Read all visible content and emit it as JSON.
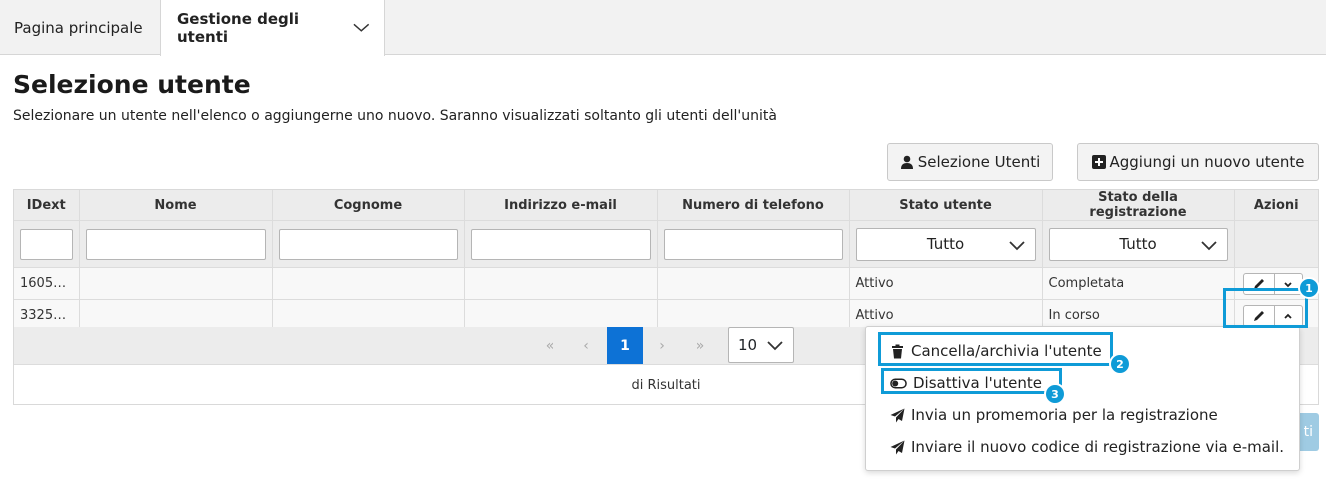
{
  "tabs": [
    {
      "label": "Pagina principale"
    },
    {
      "label": "Gestione degli utenti"
    }
  ],
  "page": {
    "title": "Selezione utente",
    "subtitle": "Selezionare un utente nell'elenco o aggiungerne uno nuovo. Saranno visualizzati soltanto gli utenti dell'unità"
  },
  "buttons": {
    "select_users": "Selezione Utenti",
    "add_user": "Aggiungi un nuovo utente",
    "ghost_text": "ti"
  },
  "table": {
    "columns": [
      "IDext",
      "Nome",
      "Cognome",
      "Indirizzo e-mail",
      "Numero di telefono",
      "Stato utente",
      "Stato della registrazione",
      "Azioni"
    ],
    "filters": {
      "stato_utente": "Tutto",
      "stato_registrazione": "Tutto"
    },
    "rows": [
      {
        "idext": "1605…",
        "nome": "",
        "cognome": "",
        "email": "",
        "telefono": "",
        "stato": "Attivo",
        "registrazione": "Completata"
      },
      {
        "idext": "3325…",
        "nome": "",
        "cognome": "",
        "email": "",
        "telefono": "",
        "stato": "Attivo",
        "registrazione": "In corso"
      }
    ]
  },
  "pager": {
    "first": "«",
    "prev": "‹",
    "current": "1",
    "next": "›",
    "last": "»",
    "page_size": "10",
    "results": "di Risultati"
  },
  "menu": {
    "items": [
      {
        "label": "Cancella/archivia l'utente",
        "icon": "trash-icon"
      },
      {
        "label": "Disattiva l'utente",
        "icon": "toggle-icon"
      },
      {
        "label": "Invia un promemoria per la registrazione",
        "icon": "paper-plane-icon"
      },
      {
        "label": "Inviare il nuovo codice di registrazione via e-mail.",
        "icon": "paper-plane-icon"
      }
    ]
  },
  "callouts": [
    "1",
    "2",
    "3"
  ],
  "colors": {
    "accent": "#0d72d6",
    "callout": "#0f9bd7",
    "header_bg": "#ececec"
  }
}
